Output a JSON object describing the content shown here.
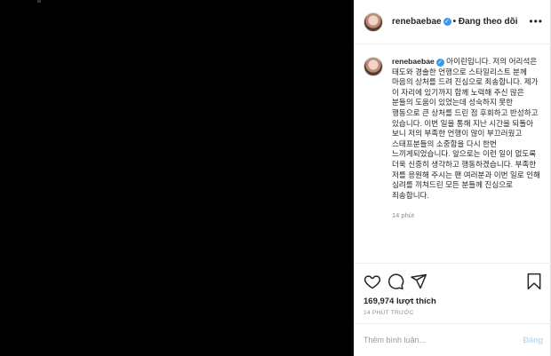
{
  "header": {
    "username": "renebaebae",
    "separator": "•",
    "follow_label": "Đang theo dõi",
    "more_icon": "more-horizontal-icon"
  },
  "caption": {
    "username": "renebaebae",
    "text": "아이린입니다. 저의 어리석은 태도와 경솔한 언행으로 스타일리스트 분께 마음의 상처를 드려 진심으로 죄송합니다. 제가 이 자리에 있기까지 함께 노력해 주신 많은 분들의 도움이 있었는데 성숙하지 못한 행동으로 큰 상처를 드린 점 후회하고 반성하고 있습니다. 이번 일을 통해 지난 시간을 되돌아 보니 저의 부족한 언행이 많이 부끄러웠고 스태프분들의 소중함을 다시 한번 느끼게되었습니다. 앞으로는 이런 일이 없도록 더욱 신중히 생각하고 행동하겠습니다. 부족한 저를 응원해 주시는 팬 여러분과 이번 일로 인해 심려를 끼쳐드린 모든 분들께 진심으로 죄송합니다.",
    "time": "14 phút"
  },
  "actions": {
    "like_icon": "heart-icon",
    "comment_icon": "comment-icon",
    "share_icon": "share-icon",
    "save_icon": "bookmark-icon"
  },
  "likes": "169,974 lượt thích",
  "posted_ago": "14 PHÚT TRƯỚC",
  "comment_input": {
    "placeholder": "Thêm bình luận...",
    "post_label": "Đăng"
  },
  "colors": {
    "verified": "#3897f0",
    "post_disabled": "#b2dffc",
    "media_bg": "#000000"
  }
}
